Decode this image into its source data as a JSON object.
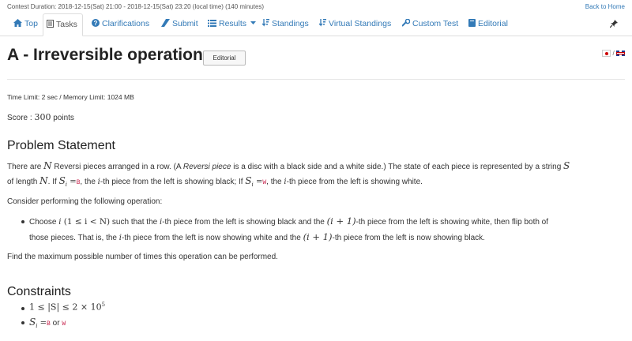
{
  "topbar": {
    "duration": "Contest Duration: 2018-12-15(Sat) 21:00 - 2018-12-15(Sat) 23:20 (local time) (140 minutes)",
    "back_link": "Back to Home"
  },
  "tabs": [
    {
      "label": "Top",
      "icon": "home-icon"
    },
    {
      "label": "Tasks",
      "icon": "tasks-icon"
    },
    {
      "label": "Clarifications",
      "icon": "question-icon"
    },
    {
      "label": "Submit",
      "icon": "submit-icon"
    },
    {
      "label": "Results",
      "icon": "list-icon"
    },
    {
      "label": "Standings",
      "icon": "sort-icon"
    },
    {
      "label": "Virtual Standings",
      "icon": "sort-icon"
    },
    {
      "label": "Custom Test",
      "icon": "wrench-icon"
    },
    {
      "label": "Editorial",
      "icon": "book-icon"
    }
  ],
  "active_tab": "Tasks",
  "problem": {
    "title": "A - Irreversible operation",
    "editorial_button": "Editorial",
    "lang_separator": "/",
    "limits": "Time Limit: 2 sec / Memory Limit: 1024 MB",
    "score_label": "Score :",
    "score_value": "300",
    "score_unit": "points"
  },
  "statement": {
    "heading": "Problem Statement",
    "l1a": "There are ",
    "l1_N": "N",
    "l1b": " Reversi pieces arranged in a row. (A ",
    "l1_italic": "Reversi piece",
    "l1c": " is a disc with a black side and a white side.) The state of each piece is represented by a string ",
    "l1_S": "S",
    "l2a": "of length ",
    "l2_N": "N",
    "l2b": ". If ",
    "l2_Si": "S",
    "l2_sub_i": "i",
    "l2_eq": " =",
    "l2_B": "B",
    "l2c": ", the ",
    "l2_i": "i",
    "l2d": "-th piece from the left is showing black; If ",
    "l2_Si2": "S",
    "l2_sub_i2": "i",
    "l2_eq2": " =",
    "l2_W": "W",
    "l2e": ", the ",
    "l2_i2": "i",
    "l2f": "-th piece from the left is showing white.",
    "consider": "Consider performing the following operation:",
    "op1a": "Choose ",
    "op1_i": "i",
    "op1_range": " (1 ≤ i < N)",
    "op1b": " such that the ",
    "op1_i2": "i",
    "op1c": "-th piece from the left is showing black and the ",
    "op1_ip1": "(i + 1)",
    "op1d": "-th piece from the left is showing white, then flip both of",
    "op2a": "those pieces. That is, the ",
    "op2_i": "i",
    "op2b": "-th piece from the left is now showing white and the ",
    "op2_ip1": "(i + 1)",
    "op2c": "-th piece from the left is now showing black.",
    "find": "Find the maximum possible number of times this operation can be performed."
  },
  "constraints": {
    "heading": "Constraints",
    "c1": "1 ≤ |S| ≤ 2 × 10",
    "c1_sup": "5",
    "c2_S": "S",
    "c2_sub": "i",
    "c2_eq": " =",
    "c2_B": "B",
    "c2_or": " or ",
    "c2_W": "W"
  }
}
